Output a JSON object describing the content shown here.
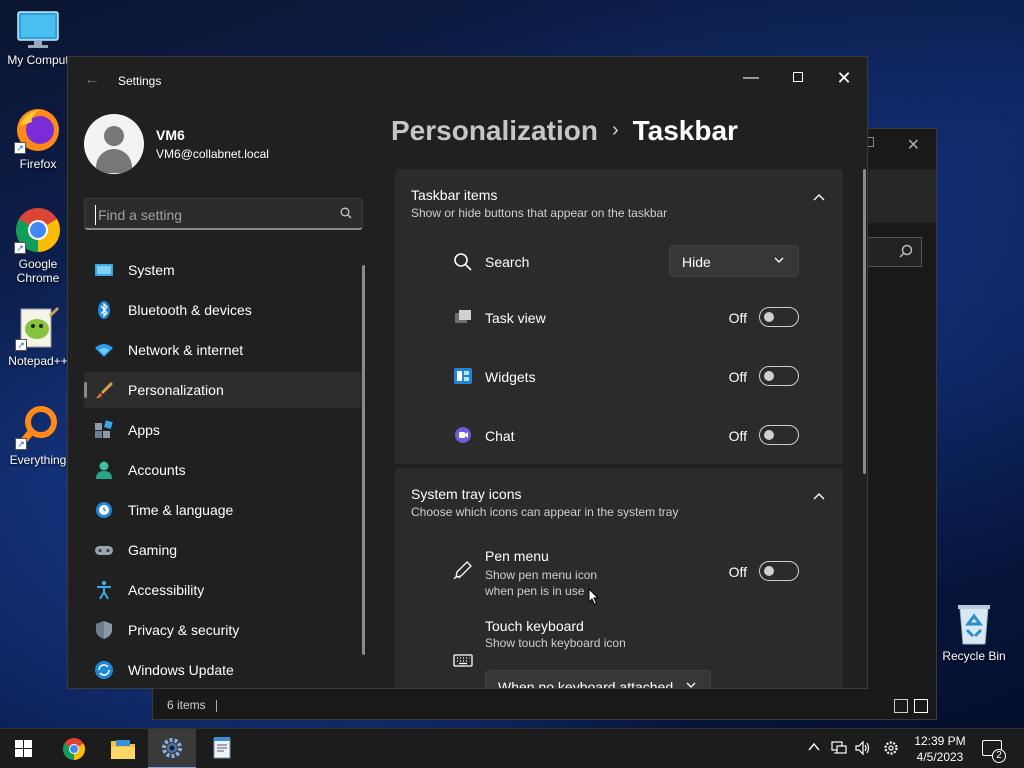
{
  "desktop": {
    "icons": [
      {
        "label": "My Comput",
        "icon": "computer-icon"
      },
      {
        "label": "Firefox",
        "icon": "firefox-icon"
      },
      {
        "label": "Google\nChrome",
        "icon": "chrome-icon"
      },
      {
        "label": "Notepad++",
        "icon": "notepad-plus-plus-icon"
      },
      {
        "label": "Everything",
        "icon": "everything-search-icon"
      },
      {
        "label": "Recycle Bin",
        "icon": "recycle-bin-icon"
      }
    ]
  },
  "background_window": {
    "status_text": "6 items",
    "close_glyph": "✕"
  },
  "settings": {
    "app_title": "Settings",
    "window_controls": {
      "minimize": "—",
      "close": "✕"
    },
    "profile": {
      "name": "VM6",
      "email": "VM6@collabnet.local"
    },
    "search": {
      "placeholder": "Find a setting"
    },
    "nav": [
      {
        "label": "System",
        "icon": "system-icon",
        "active": false
      },
      {
        "label": "Bluetooth & devices",
        "icon": "bluetooth-icon",
        "active": false
      },
      {
        "label": "Network & internet",
        "icon": "network-icon",
        "active": false
      },
      {
        "label": "Personalization",
        "icon": "brush-icon",
        "active": true
      },
      {
        "label": "Apps",
        "icon": "apps-icon",
        "active": false
      },
      {
        "label": "Accounts",
        "icon": "accounts-icon",
        "active": false
      },
      {
        "label": "Time & language",
        "icon": "time-language-icon",
        "active": false
      },
      {
        "label": "Gaming",
        "icon": "gaming-icon",
        "active": false
      },
      {
        "label": "Accessibility",
        "icon": "accessibility-icon",
        "active": false
      },
      {
        "label": "Privacy & security",
        "icon": "shield-icon",
        "active": false
      },
      {
        "label": "Windows Update",
        "icon": "windows-update-icon",
        "active": false
      }
    ],
    "breadcrumb": {
      "parent": "Personalization",
      "separator": "›",
      "current": "Taskbar"
    },
    "taskbar_items": {
      "title": "Taskbar items",
      "subtitle": "Show or hide buttons that appear on the taskbar",
      "rows": [
        {
          "label": "Search",
          "icon": "search-icon",
          "control": "dropdown",
          "value": "Hide"
        },
        {
          "label": "Task view",
          "icon": "task-view-icon",
          "control": "toggle",
          "state": "Off"
        },
        {
          "label": "Widgets",
          "icon": "widgets-icon",
          "control": "toggle",
          "state": "Off"
        },
        {
          "label": "Chat",
          "icon": "chat-icon",
          "control": "toggle",
          "state": "Off"
        }
      ]
    },
    "system_tray": {
      "title": "System tray icons",
      "subtitle": "Choose which icons can appear in the system tray",
      "pen_menu": {
        "label": "Pen menu",
        "desc": "Show pen menu icon when pen is in use",
        "state": "Off"
      },
      "touch_keyboard": {
        "label": "Touch keyboard",
        "desc": "Show touch keyboard icon",
        "value": "When no keyboard attached"
      }
    }
  },
  "taskbar": {
    "apps": [
      "start-icon",
      "chrome-icon",
      "file-explorer-icon",
      "settings-icon",
      "notepad-icon"
    ],
    "clock": {
      "time": "12:39 PM",
      "date": "4/5/2023"
    },
    "notifications_count": "2"
  },
  "colors": {
    "accent": "#7aa7e0",
    "window_bg": "#202020",
    "card_bg": "#2b2b2b"
  }
}
